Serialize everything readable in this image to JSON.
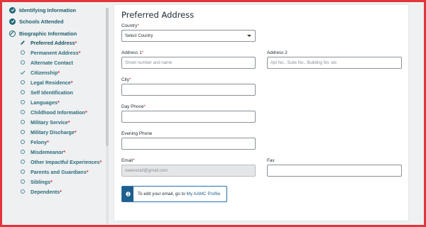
{
  "sidebar": {
    "sections": [
      {
        "label": "Identifying Information",
        "state": "complete"
      },
      {
        "label": "Schools Attended",
        "state": "complete"
      },
      {
        "label": "Biographic Information",
        "state": "in-progress"
      }
    ],
    "items": [
      {
        "label": "Preferred Address",
        "required": "*",
        "state": "current"
      },
      {
        "label": "Permanent Address",
        "required": "*",
        "state": "pending"
      },
      {
        "label": "Alternate Contact",
        "required": "",
        "state": "pending"
      },
      {
        "label": "Citizenship",
        "required": "*",
        "state": "done"
      },
      {
        "label": "Legal Residence",
        "required": "*",
        "state": "pending"
      },
      {
        "label": "Self Identification",
        "required": "",
        "state": "pending"
      },
      {
        "label": "Languages",
        "required": "*",
        "state": "pending"
      },
      {
        "label": "Childhood Information",
        "required": "*",
        "state": "pending"
      },
      {
        "label": "Military Service",
        "required": "*",
        "state": "pending"
      },
      {
        "label": "Military Discharge",
        "required": "*",
        "state": "pending"
      },
      {
        "label": "Felony",
        "required": "*",
        "state": "pending"
      },
      {
        "label": "Misdemeanor",
        "required": "*",
        "state": "pending"
      },
      {
        "label": "Other Impactful Experiences",
        "required": "*",
        "state": "pending"
      },
      {
        "label": "Parents and Guardians",
        "required": "*",
        "state": "pending"
      },
      {
        "label": "Siblings",
        "required": "*",
        "state": "pending"
      },
      {
        "label": "Dependents",
        "required": "*",
        "state": "pending"
      }
    ]
  },
  "form": {
    "title": "Preferred Address",
    "country": {
      "label": "Country",
      "required": "*",
      "value": "Select Country"
    },
    "address1": {
      "label": "Address 1",
      "required": "*",
      "placeholder": "Street number and name"
    },
    "address2": {
      "label": "Address 2",
      "placeholder": "Apt No., Suite No., Building No. etc"
    },
    "city": {
      "label": "City",
      "required": "*",
      "value": ""
    },
    "day_phone": {
      "label": "Day Phone",
      "required": "*",
      "value": ""
    },
    "evening_phone": {
      "label": "Evening Phone",
      "value": ""
    },
    "email": {
      "label": "Email",
      "required": "*",
      "value": "owenezell@gmail.com"
    },
    "fax": {
      "label": "Fax",
      "value": ""
    }
  },
  "info": {
    "text": "To edit your email, go to",
    "link": "My AAMC Profile",
    "icon": "info-icon"
  },
  "colors": {
    "accent": "#1f6676",
    "required": "#d1343a",
    "border_highlight": "#e0363c",
    "info": "#1f5f8f"
  }
}
